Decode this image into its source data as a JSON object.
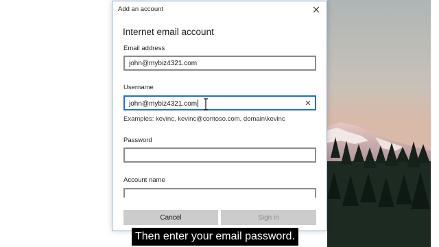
{
  "dialog": {
    "title": "Add an account",
    "heading": "Internet email account",
    "email": {
      "label": "Email address",
      "value": "john@mybiz4321.com"
    },
    "username": {
      "label": "Username",
      "value": "john@mybiz4321.com"
    },
    "examples": "Examples: kevinc, kevinc@contoso.com, domain\\kevinc",
    "password": {
      "label": "Password",
      "value": ""
    },
    "account_name": {
      "label": "Account name",
      "value": ""
    },
    "buttons": {
      "cancel": "Cancel",
      "sign_in": "Sign in"
    }
  },
  "caption": "Then enter your email password.",
  "icons": {
    "close": "close-icon",
    "clear": "clear-text-icon",
    "cursor": "text-cursor-icon"
  },
  "colors": {
    "focus_border": "#1f6fcf",
    "field_border": "#8a8a8a",
    "button_bg": "#cccccc",
    "disabled_text": "#8c8c8c"
  }
}
